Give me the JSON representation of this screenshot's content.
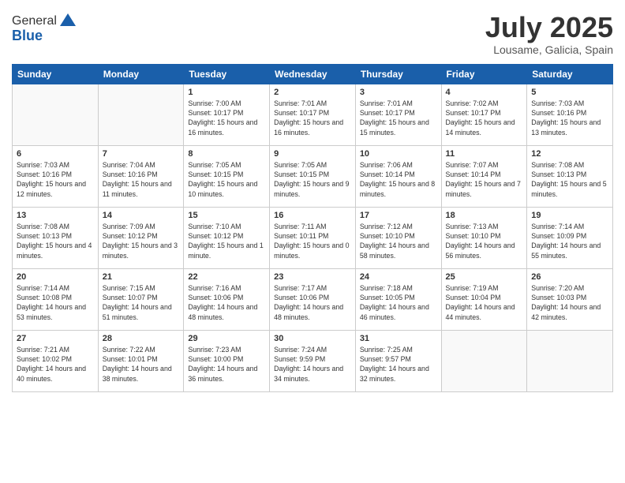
{
  "header": {
    "logo_general": "General",
    "logo_blue": "Blue",
    "month_title": "July 2025",
    "location": "Lousame, Galicia, Spain"
  },
  "weekdays": [
    "Sunday",
    "Monday",
    "Tuesday",
    "Wednesday",
    "Thursday",
    "Friday",
    "Saturday"
  ],
  "weeks": [
    [
      {
        "num": "",
        "info": ""
      },
      {
        "num": "",
        "info": ""
      },
      {
        "num": "1",
        "info": "Sunrise: 7:00 AM\nSunset: 10:17 PM\nDaylight: 15 hours and 16 minutes."
      },
      {
        "num": "2",
        "info": "Sunrise: 7:01 AM\nSunset: 10:17 PM\nDaylight: 15 hours and 16 minutes."
      },
      {
        "num": "3",
        "info": "Sunrise: 7:01 AM\nSunset: 10:17 PM\nDaylight: 15 hours and 15 minutes."
      },
      {
        "num": "4",
        "info": "Sunrise: 7:02 AM\nSunset: 10:17 PM\nDaylight: 15 hours and 14 minutes."
      },
      {
        "num": "5",
        "info": "Sunrise: 7:03 AM\nSunset: 10:16 PM\nDaylight: 15 hours and 13 minutes."
      }
    ],
    [
      {
        "num": "6",
        "info": "Sunrise: 7:03 AM\nSunset: 10:16 PM\nDaylight: 15 hours and 12 minutes."
      },
      {
        "num": "7",
        "info": "Sunrise: 7:04 AM\nSunset: 10:16 PM\nDaylight: 15 hours and 11 minutes."
      },
      {
        "num": "8",
        "info": "Sunrise: 7:05 AM\nSunset: 10:15 PM\nDaylight: 15 hours and 10 minutes."
      },
      {
        "num": "9",
        "info": "Sunrise: 7:05 AM\nSunset: 10:15 PM\nDaylight: 15 hours and 9 minutes."
      },
      {
        "num": "10",
        "info": "Sunrise: 7:06 AM\nSunset: 10:14 PM\nDaylight: 15 hours and 8 minutes."
      },
      {
        "num": "11",
        "info": "Sunrise: 7:07 AM\nSunset: 10:14 PM\nDaylight: 15 hours and 7 minutes."
      },
      {
        "num": "12",
        "info": "Sunrise: 7:08 AM\nSunset: 10:13 PM\nDaylight: 15 hours and 5 minutes."
      }
    ],
    [
      {
        "num": "13",
        "info": "Sunrise: 7:08 AM\nSunset: 10:13 PM\nDaylight: 15 hours and 4 minutes."
      },
      {
        "num": "14",
        "info": "Sunrise: 7:09 AM\nSunset: 10:12 PM\nDaylight: 15 hours and 3 minutes."
      },
      {
        "num": "15",
        "info": "Sunrise: 7:10 AM\nSunset: 10:12 PM\nDaylight: 15 hours and 1 minute."
      },
      {
        "num": "16",
        "info": "Sunrise: 7:11 AM\nSunset: 10:11 PM\nDaylight: 15 hours and 0 minutes."
      },
      {
        "num": "17",
        "info": "Sunrise: 7:12 AM\nSunset: 10:10 PM\nDaylight: 14 hours and 58 minutes."
      },
      {
        "num": "18",
        "info": "Sunrise: 7:13 AM\nSunset: 10:10 PM\nDaylight: 14 hours and 56 minutes."
      },
      {
        "num": "19",
        "info": "Sunrise: 7:14 AM\nSunset: 10:09 PM\nDaylight: 14 hours and 55 minutes."
      }
    ],
    [
      {
        "num": "20",
        "info": "Sunrise: 7:14 AM\nSunset: 10:08 PM\nDaylight: 14 hours and 53 minutes."
      },
      {
        "num": "21",
        "info": "Sunrise: 7:15 AM\nSunset: 10:07 PM\nDaylight: 14 hours and 51 minutes."
      },
      {
        "num": "22",
        "info": "Sunrise: 7:16 AM\nSunset: 10:06 PM\nDaylight: 14 hours and 48 minutes."
      },
      {
        "num": "23",
        "info": "Sunrise: 7:17 AM\nSunset: 10:06 PM\nDaylight: 14 hours and 48 minutes."
      },
      {
        "num": "24",
        "info": "Sunrise: 7:18 AM\nSunset: 10:05 PM\nDaylight: 14 hours and 46 minutes."
      },
      {
        "num": "25",
        "info": "Sunrise: 7:19 AM\nSunset: 10:04 PM\nDaylight: 14 hours and 44 minutes."
      },
      {
        "num": "26",
        "info": "Sunrise: 7:20 AM\nSunset: 10:03 PM\nDaylight: 14 hours and 42 minutes."
      }
    ],
    [
      {
        "num": "27",
        "info": "Sunrise: 7:21 AM\nSunset: 10:02 PM\nDaylight: 14 hours and 40 minutes."
      },
      {
        "num": "28",
        "info": "Sunrise: 7:22 AM\nSunset: 10:01 PM\nDaylight: 14 hours and 38 minutes."
      },
      {
        "num": "29",
        "info": "Sunrise: 7:23 AM\nSunset: 10:00 PM\nDaylight: 14 hours and 36 minutes."
      },
      {
        "num": "30",
        "info": "Sunrise: 7:24 AM\nSunset: 9:59 PM\nDaylight: 14 hours and 34 minutes."
      },
      {
        "num": "31",
        "info": "Sunrise: 7:25 AM\nSunset: 9:57 PM\nDaylight: 14 hours and 32 minutes."
      },
      {
        "num": "",
        "info": ""
      },
      {
        "num": "",
        "info": ""
      }
    ]
  ]
}
